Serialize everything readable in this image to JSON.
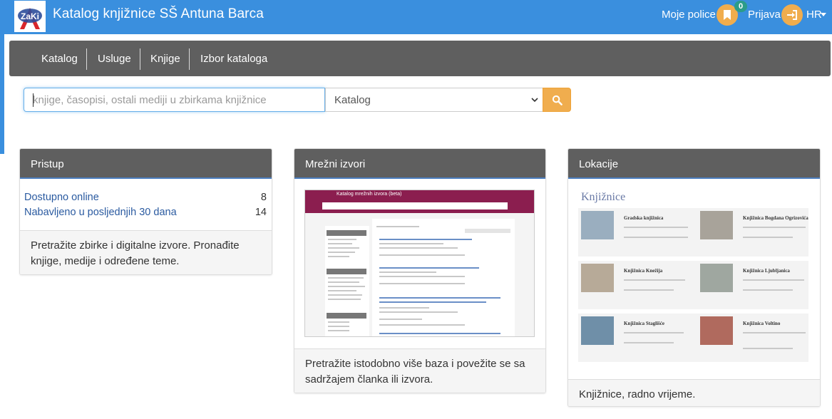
{
  "header": {
    "logo_text": "ZaKi",
    "title": "Katalog knjižnice SŠ Antuna Barca",
    "shelf_label": "Moje police",
    "shelf_count": "0",
    "login_label": "Prijava",
    "language": "HR",
    "brand_color": "#3a8fde",
    "accent_color": "#f0ad4e"
  },
  "nav": {
    "items": [
      "Katalog",
      "Usluge",
      "Knjige",
      "Izbor kataloga"
    ]
  },
  "search": {
    "placeholder": "knjige, časopisi, ostali mediji u zbirkama knjižnice",
    "scope_selected": "Katalog",
    "button_icon": "search-icon"
  },
  "cards": {
    "access": {
      "title": "Pristup",
      "rows": [
        {
          "label": "Dostupno online",
          "value": "8"
        },
        {
          "label": "Nabavljeno u posljednjih 30 dana",
          "value": "14"
        }
      ],
      "footer": "Pretražite zbirke i digitalne izvore. Pronađite knjige, medije i određene teme."
    },
    "network": {
      "title": "Mrežni izvori",
      "preview_title": "Katalog mrežnih izvora (beta)",
      "footer": "Pretražite istodobno više baza i povežite se sa sadržajem članka ili izvora."
    },
    "locations": {
      "title": "Lokacije",
      "preview_heading": "Knjižnice",
      "libraries": [
        {
          "name": "Gradska knjižnica"
        },
        {
          "name": "Knjižnica Bogdana Ogrizovića"
        },
        {
          "name": "Knjižnica Knežija"
        },
        {
          "name": "Knjižnica Ljubljanica"
        },
        {
          "name": "Knjižnica Staglišće"
        },
        {
          "name": "Knjižnica Voltino"
        }
      ],
      "footer": "Knjižnice, radno vrijeme."
    }
  }
}
